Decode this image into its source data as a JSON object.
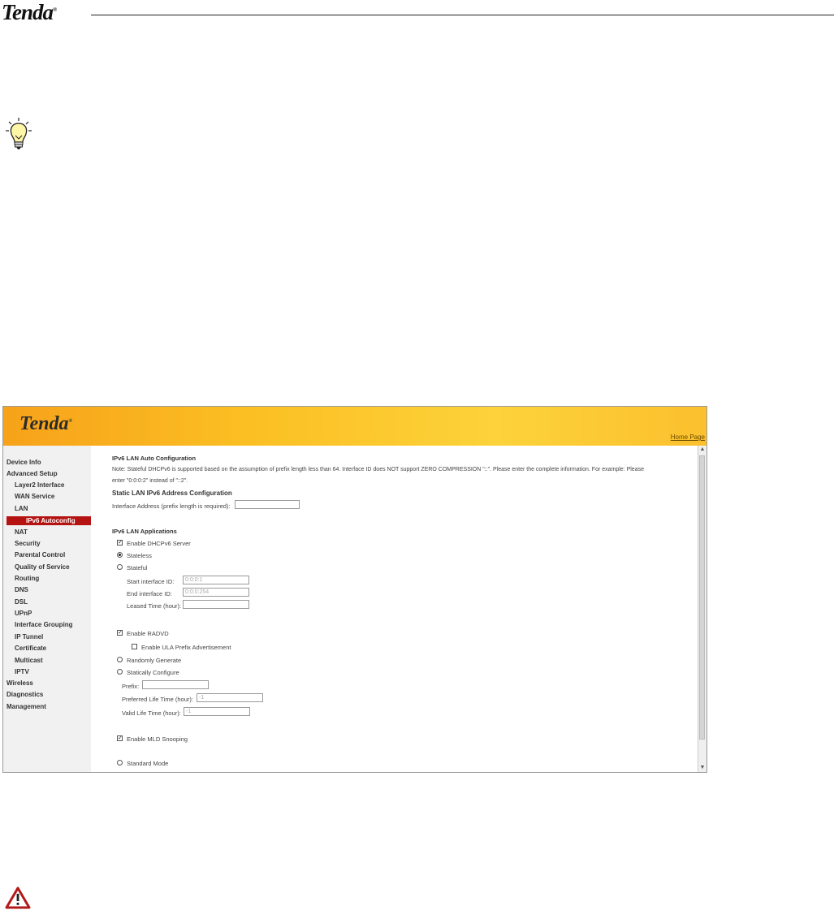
{
  "doc": {
    "logo": "Tenda",
    "logo_mark": "®"
  },
  "icons": {
    "tip": "lightbulb-icon",
    "warning": "warning-triangle-icon"
  },
  "router": {
    "logo": "Tenda",
    "logo_mark": "®",
    "home_link": "Home Page",
    "nav": [
      "Device Info",
      "Advanced Setup",
      "Layer2 Interface",
      "WAN Service",
      "LAN",
      "IPv6 Autoconfig",
      "NAT",
      "Security",
      "Parental Control",
      "Quality of Service",
      "Routing",
      "DNS",
      "DSL",
      "UPnP",
      "Interface Grouping",
      "IP Tunnel",
      "Certificate",
      "Multicast",
      "IPTV",
      "Wireless",
      "Diagnostics",
      "Management"
    ],
    "active_nav": "IPv6 Autoconfig",
    "content": {
      "title": "IPv6 LAN Auto Configuration",
      "note_line1": "Note: Stateful DHCPv6 is supported based on the assumption of prefix length less than 64. Interface ID does NOT support ZERO COMPRESSION \"::\". Please enter the complete information. For example: Please",
      "note_line2": "enter \"0:0:0:2\" instead of \"::2\".",
      "static_title": "Static LAN IPv6 Address Configuration",
      "iface_label": "Interface Address (prefix length is required):",
      "iface_value": "",
      "apps_title": "IPv6 LAN Applications",
      "enable_dhcpv6": "Enable DHCPv6 Server",
      "stateless": "Stateless",
      "stateful": "Stateful",
      "start_id_label": "Start interface ID:",
      "start_id_value": "0:0:0:1",
      "end_id_label": "End interface ID:",
      "end_id_value": "0:0:0:254",
      "leased_label": "Leased Time (hour):",
      "leased_value": "",
      "enable_radvd": "Enable RADVD",
      "enable_ula": "Enable ULA Prefix Advertisement",
      "random": "Randomly Generate",
      "static_cfg": "Statically Configure",
      "prefix_label": "Prefix:",
      "prefix_value": "",
      "pref_life_label": "Preferred Life Time (hour):",
      "pref_life_value": "-1",
      "valid_life_label": "Valid Life Time (hour):",
      "valid_life_value": "-1",
      "enable_mld": "Enable MLD Snooping",
      "standard_mode": "Standard Mode"
    }
  }
}
